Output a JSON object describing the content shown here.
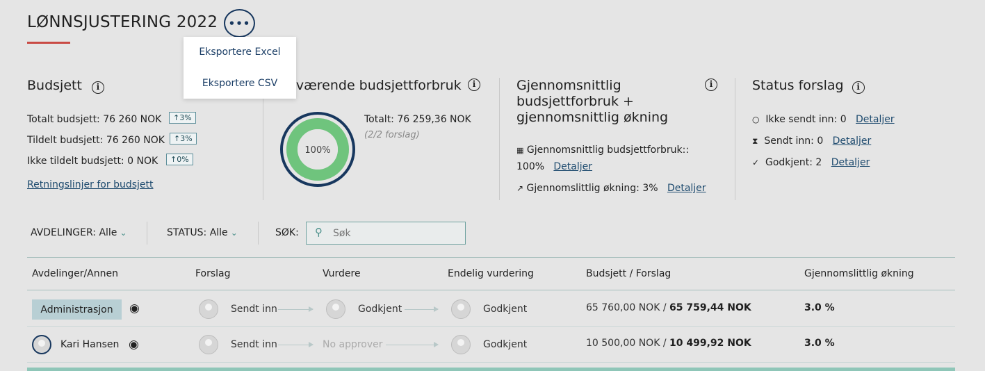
{
  "header": {
    "title": "LØNNSJUSTERING 2022",
    "more_icon": "more-horizontal-icon"
  },
  "menu": {
    "items": [
      "Eksportere Excel",
      "Eksportere CSV"
    ]
  },
  "budget": {
    "heading": "Budsjett",
    "total_label": "Totalt budsjett:",
    "total_value": "76 260 NOK",
    "total_badge": "↑3%",
    "assigned_label": "Tildelt budsjett:",
    "assigned_value": "76 260 NOK",
    "assigned_badge": "↑3%",
    "unassigned_label": "Ikke tildelt budsjett:",
    "unassigned_value": "0 NOK",
    "unassigned_badge": "↑0%",
    "guideline_link": "Retningslinjer for budsjett"
  },
  "usage": {
    "heading": "Nåværende budsjettforbruk",
    "donut_label": "100%",
    "percent": 100,
    "total_label": "Totalt:",
    "total_value": "76 259,36 NOK",
    "proposals_note": "(2/2 forslag)",
    "color": "#6fc47d"
  },
  "average": {
    "heading_line1": "Gjennomsnittlig",
    "heading_line2": "budsjettforbruk +",
    "heading_line3": "gjennomsnittlig økning",
    "usage_label": "Gjennomsnittlig budsjettforbruk::",
    "usage_value": "100%",
    "increase_label": "Gjennomslittlig økning:",
    "increase_value": "3%",
    "details": "Detaljer"
  },
  "status": {
    "heading": "Status forslag",
    "not_sent_label": "Ikke sendt inn:",
    "not_sent_value": "0",
    "sent_label": "Sendt inn:",
    "sent_value": "0",
    "approved_label": "Godkjent:",
    "approved_value": "2",
    "details": "Detaljer"
  },
  "filters": {
    "departments_label": "AVDELINGER:",
    "departments_value": "Alle",
    "status_label": "STATUS:",
    "status_value": "Alle",
    "search_label": "SØK:",
    "search_placeholder": "Søk"
  },
  "table": {
    "headers": [
      "Avdelinger/Annen",
      "Forslag",
      "Vurdere",
      "Endelig vurdering",
      "Budsjett / Forslag",
      "Gjennomslittlig økning"
    ],
    "rows": [
      {
        "name": "Administrasjon",
        "proposal": "Sendt inn",
        "review": "Godkjent",
        "final": "Godkjent",
        "budget": "65 760,00 NOK",
        "proposal_amount": "65 759,44 NOK",
        "increase": "3.0 %"
      },
      {
        "name": "Kari Hansen",
        "proposal": "Sendt inn",
        "review": "No approver",
        "final": "Godkjent",
        "budget": "10 500,00 NOK",
        "proposal_amount": "10 499,92 NOK",
        "increase": "3.0 %"
      }
    ]
  }
}
